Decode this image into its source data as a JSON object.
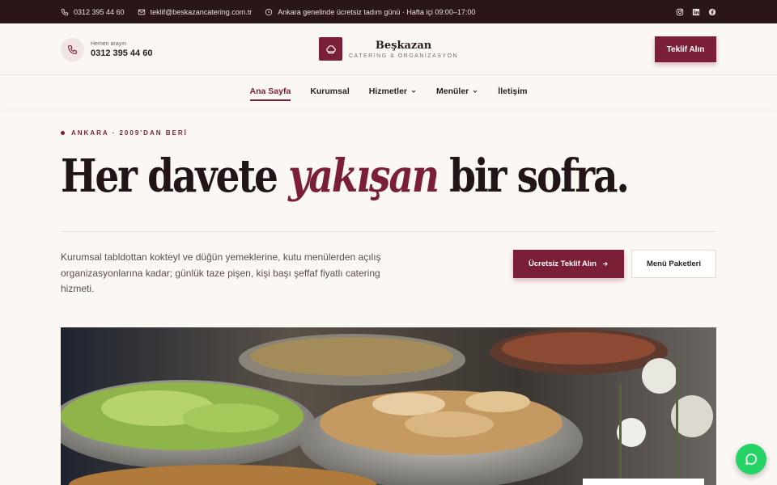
{
  "topbar": {
    "phone": "0312 395 44 60",
    "email": "teklif@beskazancatering.com.tr",
    "info": "Ankara genelinde ücretsiz tadım günü · Hafta içi 09:00–17:00",
    "social": [
      "instagram-icon",
      "linkedin-icon",
      "facebook-icon"
    ]
  },
  "header": {
    "call_small": "Hemen arayın",
    "call_number": "0312 395 44 60",
    "brand_name": "Beşkazan",
    "brand_tagline": "CATERING & ORGANİZASYON",
    "cta_label": "Teklif Alın"
  },
  "nav": {
    "items": [
      {
        "label": "Ana Sayfa",
        "active": true
      },
      {
        "label": "Kurumsal"
      },
      {
        "label": "Hizmetler",
        "dropdown": true
      },
      {
        "label": "Menüler",
        "dropdown": true
      },
      {
        "label": "İletişim"
      }
    ]
  },
  "hero": {
    "eyebrow": "ANKARA · 2009'DAN BERİ",
    "headline_pre": "Her davete ",
    "headline_em": "yakışan",
    "headline_post": " bir sofra.",
    "description": "Kurumsal tabldottan kokteyl ve düğün yemeklerine, kutu menülerden açılış organizasyonlarına kadar; günlük taze pişen, kişi başı şeffaf fiyatlı catering hizmeti.",
    "primary_cta": "Ücretsiz Teklif Alın",
    "secondary_cta": "Menü Paketleri"
  },
  "colors": {
    "brand": "#7a1f35",
    "topbar_bg": "#2a1619",
    "page_bg": "#fbf8f4",
    "whatsapp": "#25d366"
  }
}
